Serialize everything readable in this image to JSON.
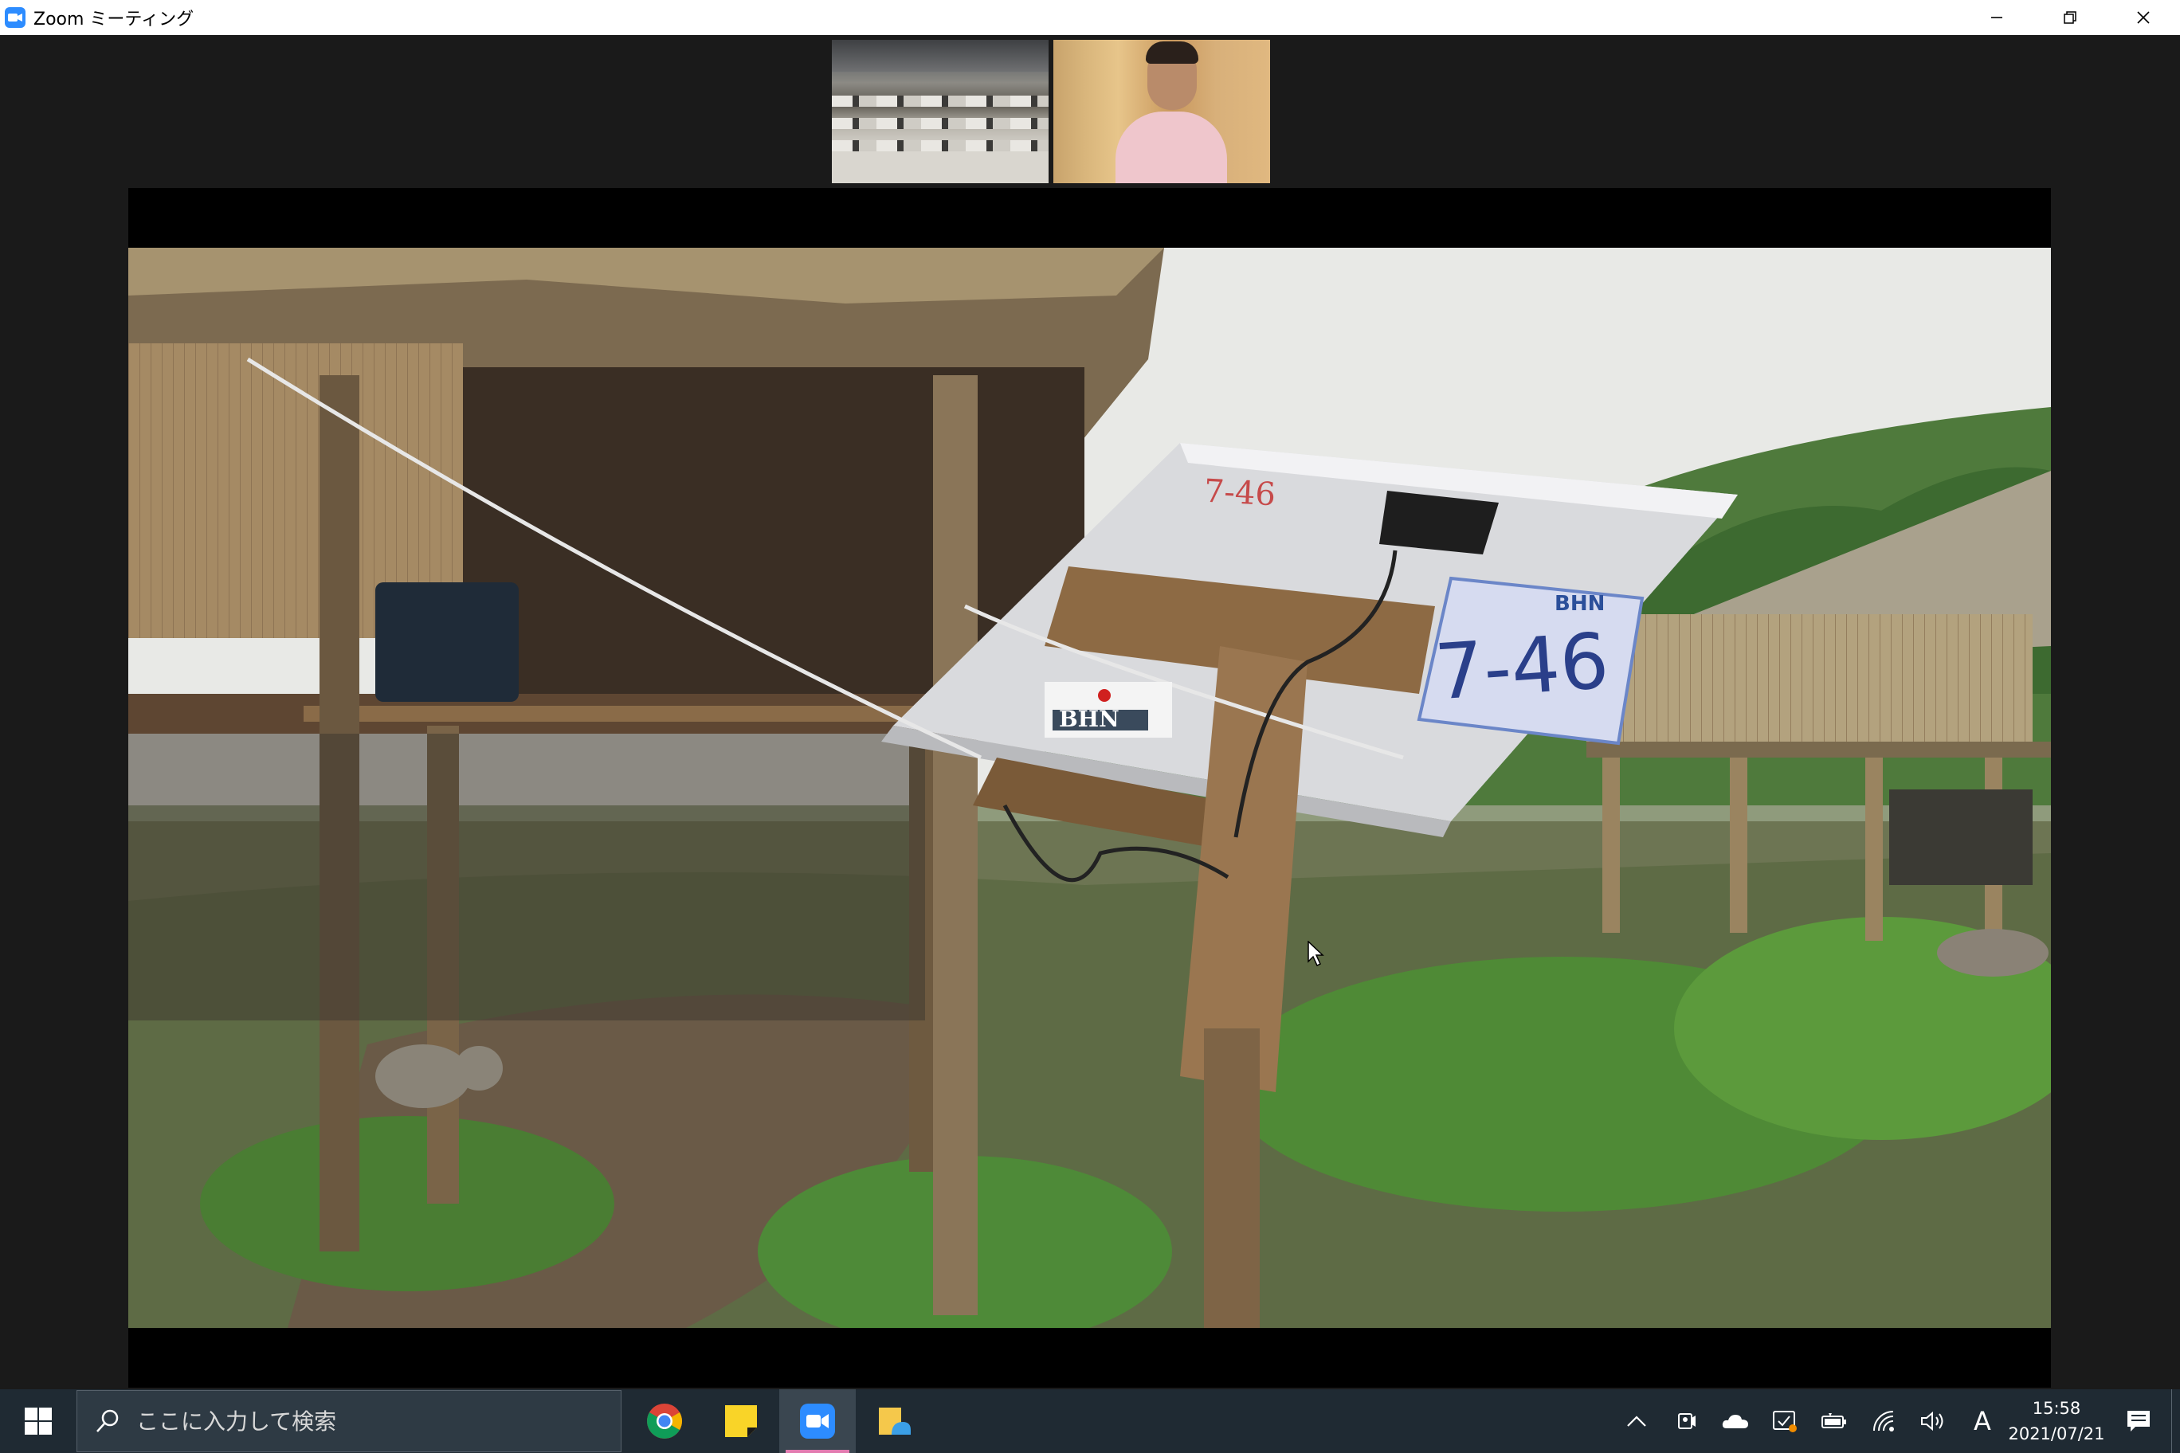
{
  "window": {
    "title": "Zoom ミーティング",
    "app_icon": "zoom-camera-icon",
    "controls": [
      "minimize-icon",
      "restore-icon",
      "close-icon"
    ]
  },
  "meeting": {
    "participants": [
      {
        "tile": "classroom-video",
        "description_icon": "video-tile"
      },
      {
        "tile": "speaker-video",
        "description_icon": "video-tile"
      }
    ],
    "shared_video": {
      "panel_label_large": "7-46",
      "panel_label_small_line1": "7-46",
      "panel_brand": "BHN",
      "card_brand": "BHN"
    }
  },
  "taskbar": {
    "search_placeholder": "ここに入力して検索",
    "apps": [
      "chrome-icon",
      "sticky-notes-icon",
      "zoom-icon",
      "file-explorer-icon"
    ],
    "active_app": "zoom-icon",
    "tray_icons": [
      "chevron-up-icon",
      "meet-now-icon",
      "onedrive-icon",
      "security-icon",
      "battery-icon",
      "wifi-icon",
      "volume-icon"
    ],
    "ime": "A",
    "time": "15:58",
    "date": "2021/07/21"
  },
  "colors": {
    "zoom_blue": "#2d8cff",
    "taskbar": "#1f2a33",
    "meeting_bg": "#1a1a1a"
  }
}
